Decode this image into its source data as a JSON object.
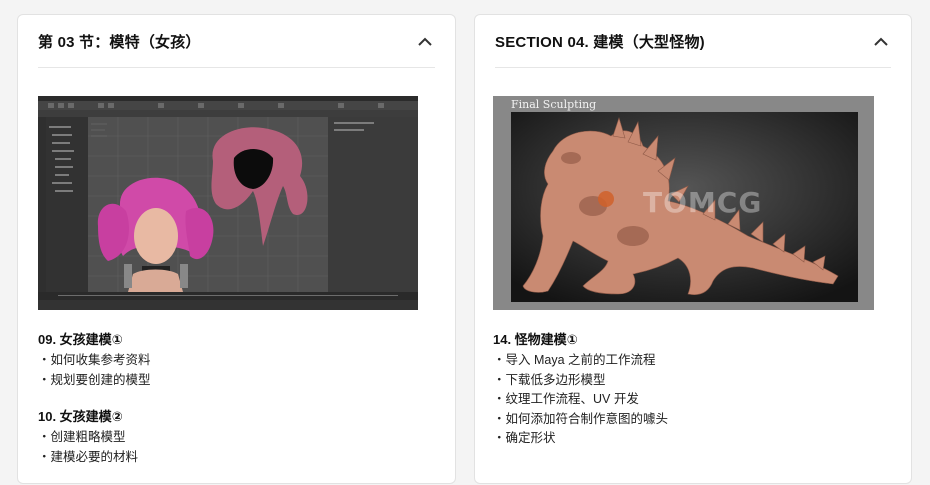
{
  "sections": [
    {
      "title": "第 03 节：模特（女孩）",
      "lessons": [
        {
          "title": "09. 女孩建模①",
          "items": [
            "如何收集参考资料",
            "规划要创建的模型"
          ]
        },
        {
          "title": "10. 女孩建模②",
          "items": [
            "创建粗略模型",
            "建模必要的材料"
          ]
        }
      ]
    },
    {
      "title": "SECTION 04. 建模（大型怪物)",
      "image": {
        "caption": "Final Sculpting",
        "watermark": "TOMCG"
      },
      "lessons": [
        {
          "title": "14. 怪物建模①",
          "items": [
            "导入 Maya 之前的工作流程",
            "下载低多边形模型",
            "纹理工作流程、UV 开发",
            "如何添加符合制作意图的噱头",
            "确定形状"
          ]
        }
      ]
    }
  ],
  "colors": {
    "accent": "#222222",
    "maya_bg": "#444444",
    "clay": "#c98a72"
  }
}
